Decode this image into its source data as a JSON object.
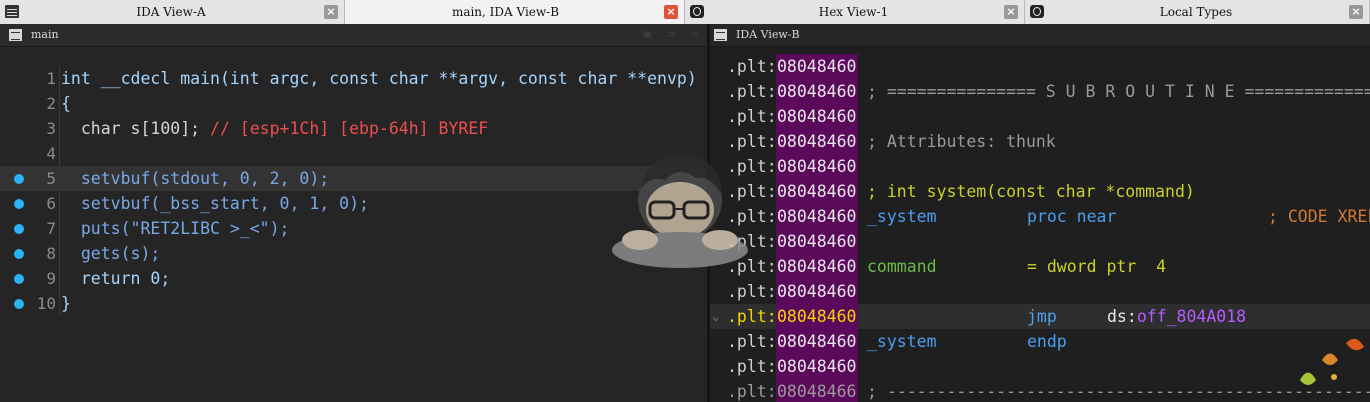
{
  "tabs": [
    {
      "title": "IDA View-A",
      "icon": "grid-icon",
      "active": false
    },
    {
      "title": "main, IDA View-B",
      "icon": "none",
      "active": true
    },
    {
      "title": "Hex View-1",
      "icon": "hex-icon",
      "active": false
    },
    {
      "title": "Local Types",
      "icon": "types-icon",
      "active": false
    }
  ],
  "pseudocode": {
    "title": "main",
    "lines": [
      {
        "num": "1",
        "text": "int __cdecl main(int argc, const char **argv, const char **envp)"
      },
      {
        "num": "2",
        "text": "{"
      },
      {
        "num": "3",
        "text": "  char s[100]; ",
        "comment": "// [esp+1Ch] [ebp-64h] BYREF"
      },
      {
        "num": "4",
        "text": ""
      },
      {
        "num": "5",
        "text": "  setvbuf(stdout, 0, 2, 0);"
      },
      {
        "num": "6",
        "text": "  setvbuf(_bss_start, 0, 1, 0);"
      },
      {
        "num": "7",
        "text": "  puts(\"RET2LIBC >_<\");"
      },
      {
        "num": "8",
        "text": "  gets(s);"
      },
      {
        "num": "9",
        "text": "  return 0;"
      },
      {
        "num": "10",
        "text": "}"
      }
    ]
  },
  "disasm": {
    "title": "IDA View-B",
    "rows": [
      {
        "seg": ".plt:",
        "addr": "08048460",
        "text": ""
      },
      {
        "seg": ".plt:",
        "addr": "08048460",
        "text": "; =============== S U B R O U T I N E ======================================="
      },
      {
        "seg": ".plt:",
        "addr": "08048460",
        "text": ""
      },
      {
        "seg": ".plt:",
        "addr": "08048460",
        "text": "; Attributes: thunk"
      },
      {
        "seg": ".plt:",
        "addr": "08048460",
        "text": ""
      },
      {
        "seg": ".plt:",
        "addr": "08048460",
        "text": "; int system(const char *command)"
      },
      {
        "seg": ".plt:",
        "addr": "08048460",
        "label": "_system",
        "mnem": "proc near",
        "cmt": "; CODE XREF"
      },
      {
        "seg": ".plt:",
        "addr": "08048460",
        "text": ""
      },
      {
        "seg": ".plt:",
        "addr": "08048460",
        "label": "command",
        "mnem": "= dword ptr  4"
      },
      {
        "seg": ".plt:",
        "addr": "08048460",
        "text": ""
      },
      {
        "seg": ".plt:",
        "addr": "08048460",
        "mnem": "jmp",
        "operand_prefix": "ds:",
        "operand": "off_804A018"
      },
      {
        "seg": ".plt:",
        "addr": "08048460",
        "label": "_system",
        "mnem": "endp"
      },
      {
        "seg": ".plt:",
        "addr": "08048460",
        "text": ""
      },
      {
        "seg": ".plt:",
        "addr": "08048466",
        "text": "; ---------------------------------------------------------------------------"
      }
    ]
  }
}
